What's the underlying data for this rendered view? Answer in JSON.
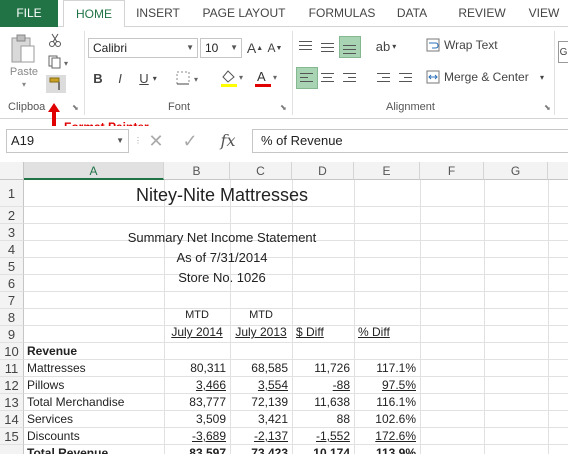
{
  "tabs": [
    "FILE",
    "HOME",
    "INSERT",
    "PAGE LAYOUT",
    "FORMULAS",
    "DATA",
    "REVIEW",
    "VIEW"
  ],
  "ribbon": {
    "clipboard": {
      "paste_label": "Paste",
      "group_label": "Clipboa"
    },
    "font": {
      "font_name": "Calibri",
      "font_size": "10",
      "group_label": "Font",
      "highlight_color": "#ffff00",
      "font_color": "#e00000"
    },
    "alignment": {
      "wrap_text": "Wrap Text",
      "merge_center": "Merge & Center",
      "group_label": "Alignment"
    }
  },
  "annotation": {
    "label": "Format Painter",
    "color": "#e00000"
  },
  "formula_bar": {
    "name_box": "A19",
    "fx": "fx",
    "formula": "% of Revenue"
  },
  "columns": [
    "A",
    "B",
    "C",
    "D",
    "E",
    "F",
    "G"
  ],
  "rows": [
    "1",
    "2",
    "3",
    "4",
    "5",
    "6",
    "7",
    "8",
    "9",
    "10",
    "11",
    "12",
    "13",
    "14",
    "15"
  ],
  "sheet": {
    "title": "Nitey-Nite Mattresses",
    "subtitle1": "Summary Net Income Statement",
    "subtitle2": "As of 7/31/2014",
    "subtitle3": "Store No. 1026",
    "hdr_mtd1": "MTD",
    "hdr_mtd2": "MTD",
    "hdr_jul2014": "July 2014",
    "hdr_jul2013": "July 2013",
    "hdr_diff": "$ Diff",
    "hdr_pdiff": "% Diff",
    "revenue": "Revenue",
    "lines": [
      {
        "label": "Mattresses",
        "b": "80,311",
        "c": "68,585",
        "d": "11,726",
        "e": "117.1%"
      },
      {
        "label": "Pillows",
        "b": "3,466",
        "c": "3,554",
        "d": "-88",
        "e": "97.5%"
      },
      {
        "label": "Total Merchandise",
        "b": "83,777",
        "c": "72,139",
        "d": "11,638",
        "e": "116.1%"
      },
      {
        "label": "Services",
        "b": "3,509",
        "c": "3,421",
        "d": "88",
        "e": "102.6%"
      },
      {
        "label": "Discounts",
        "b": "-3,689",
        "c": "-2,137",
        "d": "-1,552",
        "e": "172.6%"
      },
      {
        "label": "Total Revenue",
        "b": "83,597",
        "c": "73,423",
        "d": "10,174",
        "e": "113.9%"
      }
    ]
  }
}
